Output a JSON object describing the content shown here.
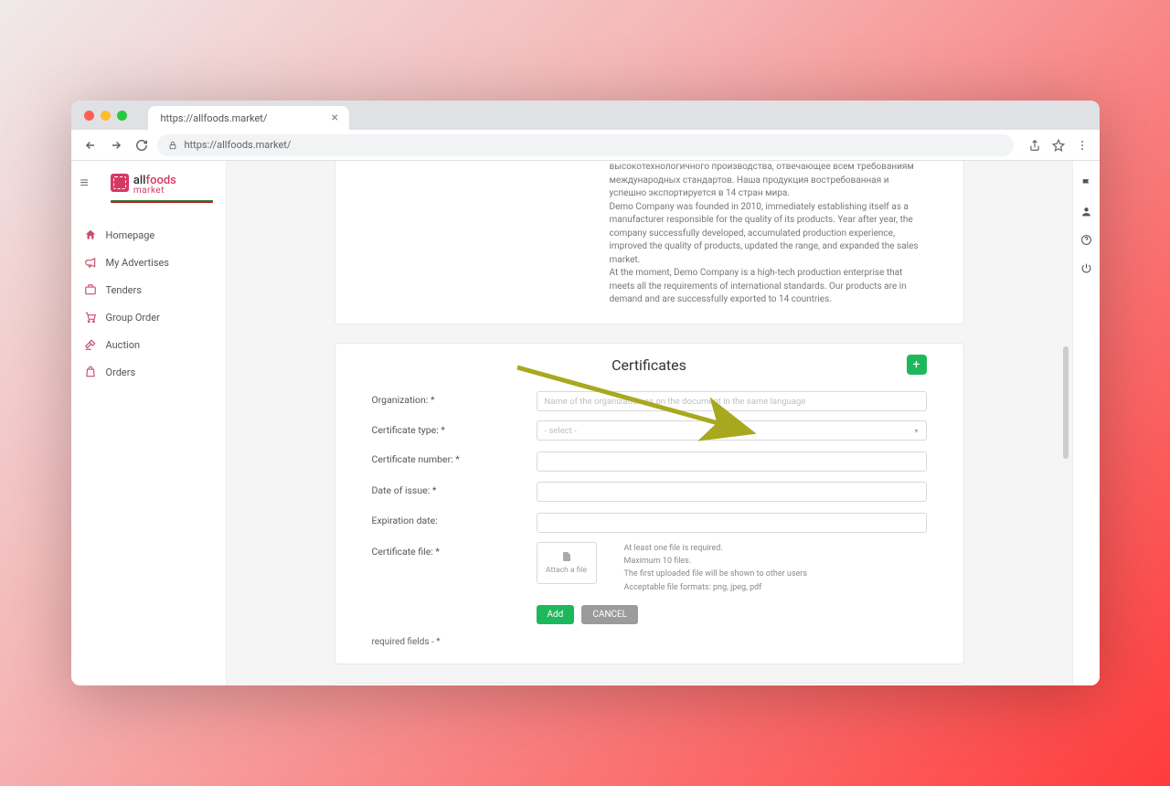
{
  "browser": {
    "tab_title": "https://allfoods.market/",
    "url": "https://allfoods.market/"
  },
  "logo": {
    "all": "all",
    "foods": "foods",
    "sub": "market"
  },
  "sidebar": {
    "items": [
      {
        "label": "Homepage"
      },
      {
        "label": "My Advertises"
      },
      {
        "label": "Tenders"
      },
      {
        "label": "Group Order"
      },
      {
        "label": "Auction"
      },
      {
        "label": "Orders"
      }
    ]
  },
  "top_block": {
    "line1": "высокотехнологичного производства, отвечающее всем требованиям международных стандартов. Наша продукция востребованная и успешно экспортируется в 14 стран мира.",
    "line2": "Demo Company was founded in 2010, immediately establishing itself as a manufacturer responsible for the quality of its products. Year after year, the company successfully developed, accumulated production experience, improved the quality of products, updated the range, and expanded the sales market.",
    "line3": "At the moment, Demo Company is a high-tech production enterprise that meets all the requirements of international standards. Our products are in demand and are successfully exported to 14 countries."
  },
  "cert": {
    "title": "Certificates",
    "fields": {
      "organization": "Organization: *",
      "organization_placeholder": "Name of the organization as on the document in the same language",
      "cert_type": "Certificate type: *",
      "cert_type_placeholder": "- select -",
      "cert_number": "Certificate number: *",
      "date_issue": "Date of issue: *",
      "expiration": "Expiration date:",
      "cert_file": "Certificate file: *",
      "attach": "Attach a file"
    },
    "hints": {
      "h1": "At least one file is required.",
      "h2": "Maximum 10 files.",
      "h3": "The first uploaded file will be shown to other users",
      "h4": "Acceptable file formats: png, jpeg, pdf"
    },
    "add_btn": "Add",
    "cancel_btn": "CANCEL",
    "required_note": "required fields - *",
    "plus": "+"
  },
  "colors": {
    "accent_green": "#1eb85c",
    "brand_pink": "#d63864"
  }
}
